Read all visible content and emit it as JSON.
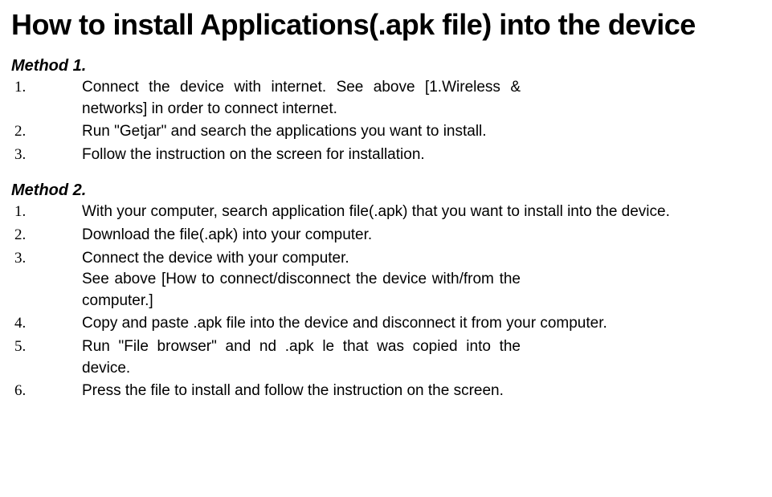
{
  "title": "How to install Applications(.apk file) into the device",
  "method1": {
    "heading": "Method 1.",
    "items": [
      {
        "num": "1.",
        "text": "Connect the device with internet. See above [1.Wireless & networks] in order to connect internet."
      },
      {
        "num": "2.",
        "text": "Run \"Getjar\" and search the applications you want to install."
      },
      {
        "num": "3.",
        "text": "Follow the instruction on the screen for installation."
      }
    ]
  },
  "method2": {
    "heading": "Method 2.",
    "items": [
      {
        "num": "1.",
        "text": "With your computer, search application file(.apk) that you want to install into the device."
      },
      {
        "num": "2.",
        "text": "Download the file(.apk) into your computer."
      },
      {
        "num": "3.",
        "text": "Connect the device with your computer.",
        "extra": "See above [How to connect/disconnect the device with/from the computer.]"
      },
      {
        "num": "4.",
        "text": "Copy and paste .apk file into the device and disconnect it from your computer."
      },
      {
        "num": "5.",
        "text": "Run \"File browser\" and  nd .apk  le that was copied into the device."
      },
      {
        "num": "6.",
        "text": "Press the file to install and follow the instruction on the screen."
      }
    ]
  }
}
